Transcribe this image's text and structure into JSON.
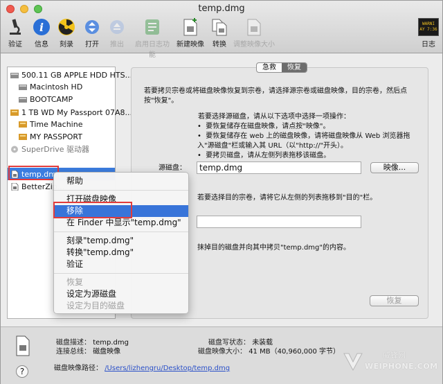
{
  "window": {
    "title": "temp.dmg"
  },
  "toolbar": {
    "verify": "验证",
    "info": "信息",
    "burn": "刻录",
    "open": "打开",
    "eject": "推出",
    "enable_journaling": "启用日志功能",
    "new_image": "新建映像",
    "convert": "转换",
    "resize_image": "调整映像大小",
    "log": "日志",
    "log_badge_line1": "WARNI",
    "log_badge_line2": "AY 7:36"
  },
  "sidebar": {
    "items": [
      {
        "label": "500.11 GB APPLE HDD HTS..."
      },
      {
        "label": "Macintosh HD"
      },
      {
        "label": "BOOTCAMP"
      },
      {
        "label": "1 TB WD My Passport 07A8..."
      },
      {
        "label": "Time Machine"
      },
      {
        "label": "MY PASSPORT"
      },
      {
        "label": "SuperDrive 驱动器"
      },
      {
        "label": "temp.dmg"
      },
      {
        "label": "BetterZip..."
      }
    ]
  },
  "tabs": {
    "first_aid": "急救",
    "restore": "恢复"
  },
  "restore": {
    "intro": "若要拷贝宗卷或将磁盘映像恢复到宗卷，请选择源宗卷或磁盘映像，目的宗卷，然后点按\"恢复\"。",
    "steps_title": "若要选择源磁盘，请从以下选项中选择一项操作：",
    "step1": "要恢复储存在磁盘映像，请点按\"映像\"。",
    "step2": "要恢复储存在 web 上的磁盘映像，请将磁盘映像从 Web 浏览器拖入\"源磁盘\"栏或输入其 URL（以\"http://\"开头）。",
    "step3": "要拷贝磁盘，请从左侧列表拖移该磁盘。",
    "source_label": "源磁盘：",
    "source_value": "temp.dmg",
    "image_button": "映像...",
    "dest_hint": "若要选择目的宗卷，请将它从左侧的列表拖移到\"目的\"栏。",
    "dest_value": "",
    "erase_text": "抹掉目的磁盘并向其中拷贝\"temp.dmg\"的内容。",
    "restore_button": "恢复"
  },
  "context_menu": {
    "items": [
      {
        "label": "帮助"
      },
      {
        "label": "打开磁盘映像"
      },
      {
        "label": "移除"
      },
      {
        "label": "在 Finder 中显示\"temp.dmg\""
      },
      {
        "label": "刻录\"temp.dmg\""
      },
      {
        "label": "转换\"temp.dmg\""
      },
      {
        "label": "验证"
      },
      {
        "label": "恢复"
      },
      {
        "label": "设定为源磁盘"
      },
      {
        "label": "设定为目的磁盘"
      }
    ]
  },
  "info": {
    "desc_k": "磁盘描述：",
    "desc_v": "temp.dmg",
    "bus_k": "连接总线：",
    "bus_v": "磁盘映像",
    "write_k": "磁盘写状态：",
    "write_v": "未装载",
    "size_k": "磁盘映像大小：",
    "size_v": "41 MB（40,960,000 字节）",
    "path_k": "磁盘映像路径：",
    "path_v": "/Users/lizhengru/Desktop/temp.dmg",
    "help": "?",
    "watermark_cn": "威锋网",
    "watermark_en": "WEIPHONE.COM"
  }
}
